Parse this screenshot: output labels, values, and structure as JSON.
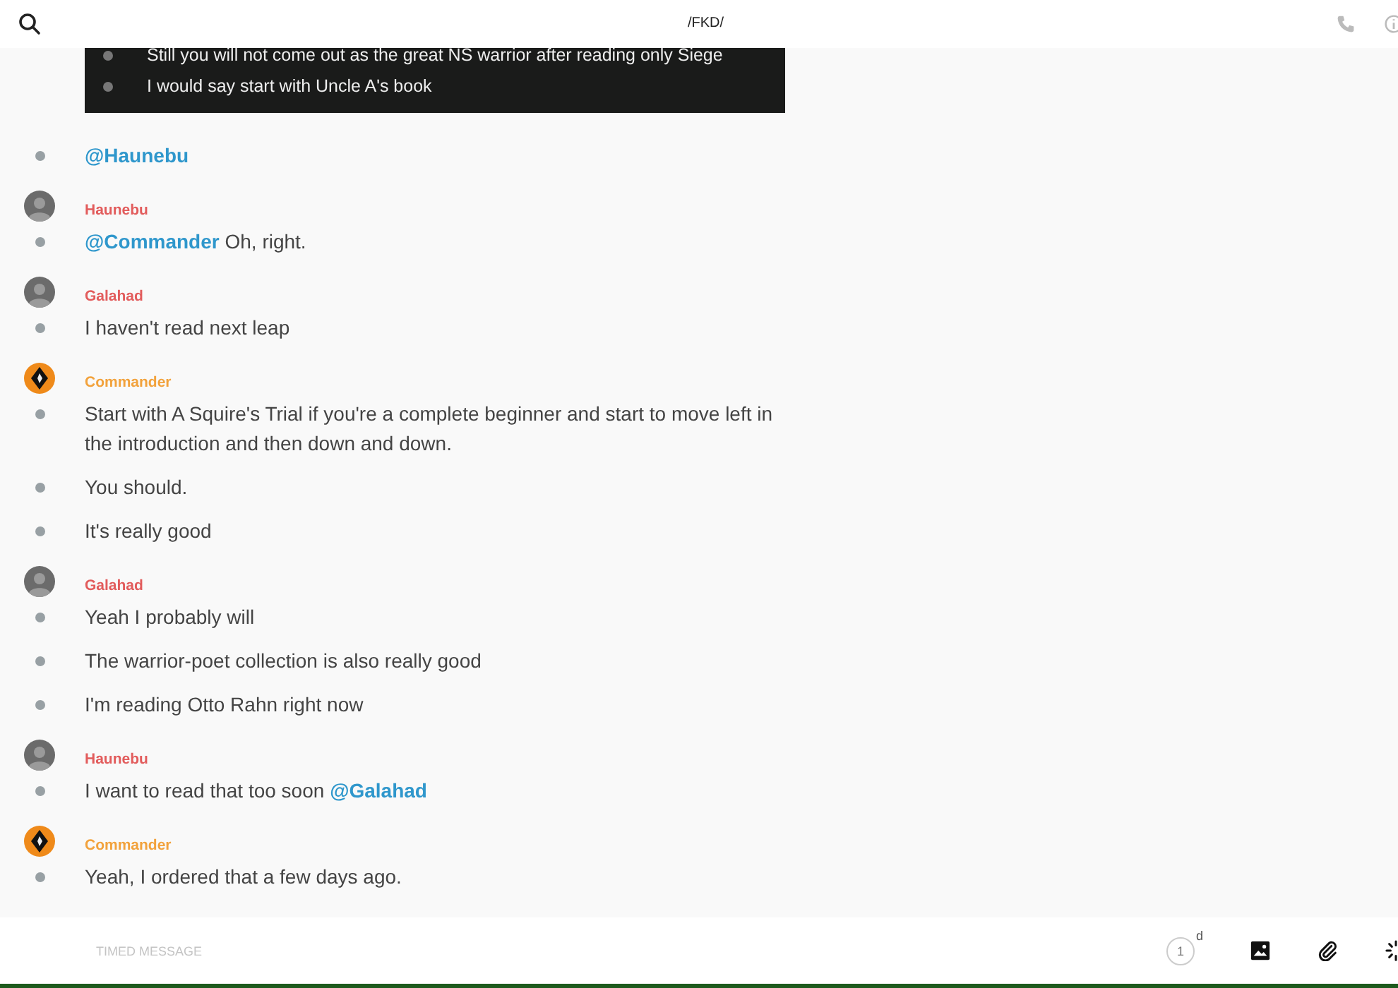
{
  "header": {
    "title": "/FKD/"
  },
  "embedded_screenshot": {
    "lines": [
      "Still you will not come out as the great NS warrior after reading only Siege",
      "I would say start with Uncle A's book"
    ]
  },
  "groups": [
    {
      "messages": [
        [
          {
            "kind": "mention",
            "text": "@Haunebu"
          }
        ]
      ]
    },
    {
      "author": {
        "name": "Haunebu",
        "color": "#e25c5c",
        "kind": "photo"
      },
      "messages": [
        [
          {
            "kind": "mention",
            "text": "@Commander"
          },
          {
            "kind": "text",
            "text": " Oh, right."
          }
        ]
      ]
    },
    {
      "author": {
        "name": "Galahad",
        "color": "#e25c5c",
        "kind": "photo"
      },
      "messages": [
        [
          {
            "kind": "text",
            "text": "I haven't read next leap"
          }
        ]
      ]
    },
    {
      "author": {
        "name": "Commander",
        "color": "#f2a23c",
        "kind": "emblem"
      },
      "messages": [
        [
          {
            "kind": "text",
            "text": "Start with A Squire's Trial if you're a complete beginner and start to move left in the introduction and then down and down."
          }
        ],
        [
          {
            "kind": "text",
            "text": "You should."
          }
        ],
        [
          {
            "kind": "text",
            "text": "It's really good"
          }
        ]
      ]
    },
    {
      "author": {
        "name": "Galahad",
        "color": "#e25c5c",
        "kind": "photo"
      },
      "messages": [
        [
          {
            "kind": "text",
            "text": "Yeah I probably will"
          }
        ],
        [
          {
            "kind": "text",
            "text": "The warrior-poet collection is also really good"
          }
        ],
        [
          {
            "kind": "text",
            "text": "I'm reading Otto Rahn right now"
          }
        ]
      ]
    },
    {
      "author": {
        "name": "Haunebu",
        "color": "#e25c5c",
        "kind": "photo"
      },
      "messages": [
        [
          {
            "kind": "text",
            "text": "I want to read that too soon "
          },
          {
            "kind": "mention",
            "text": "@Galahad"
          }
        ]
      ]
    },
    {
      "author": {
        "name": "Commander",
        "color": "#f2a23c",
        "kind": "emblem"
      },
      "messages": [
        [
          {
            "kind": "text",
            "text": "Yeah, I ordered that a few days ago."
          }
        ]
      ]
    }
  ],
  "composer": {
    "placeholder": "TIMED MESSAGE",
    "timer": {
      "value": "1",
      "unit": "d"
    }
  }
}
